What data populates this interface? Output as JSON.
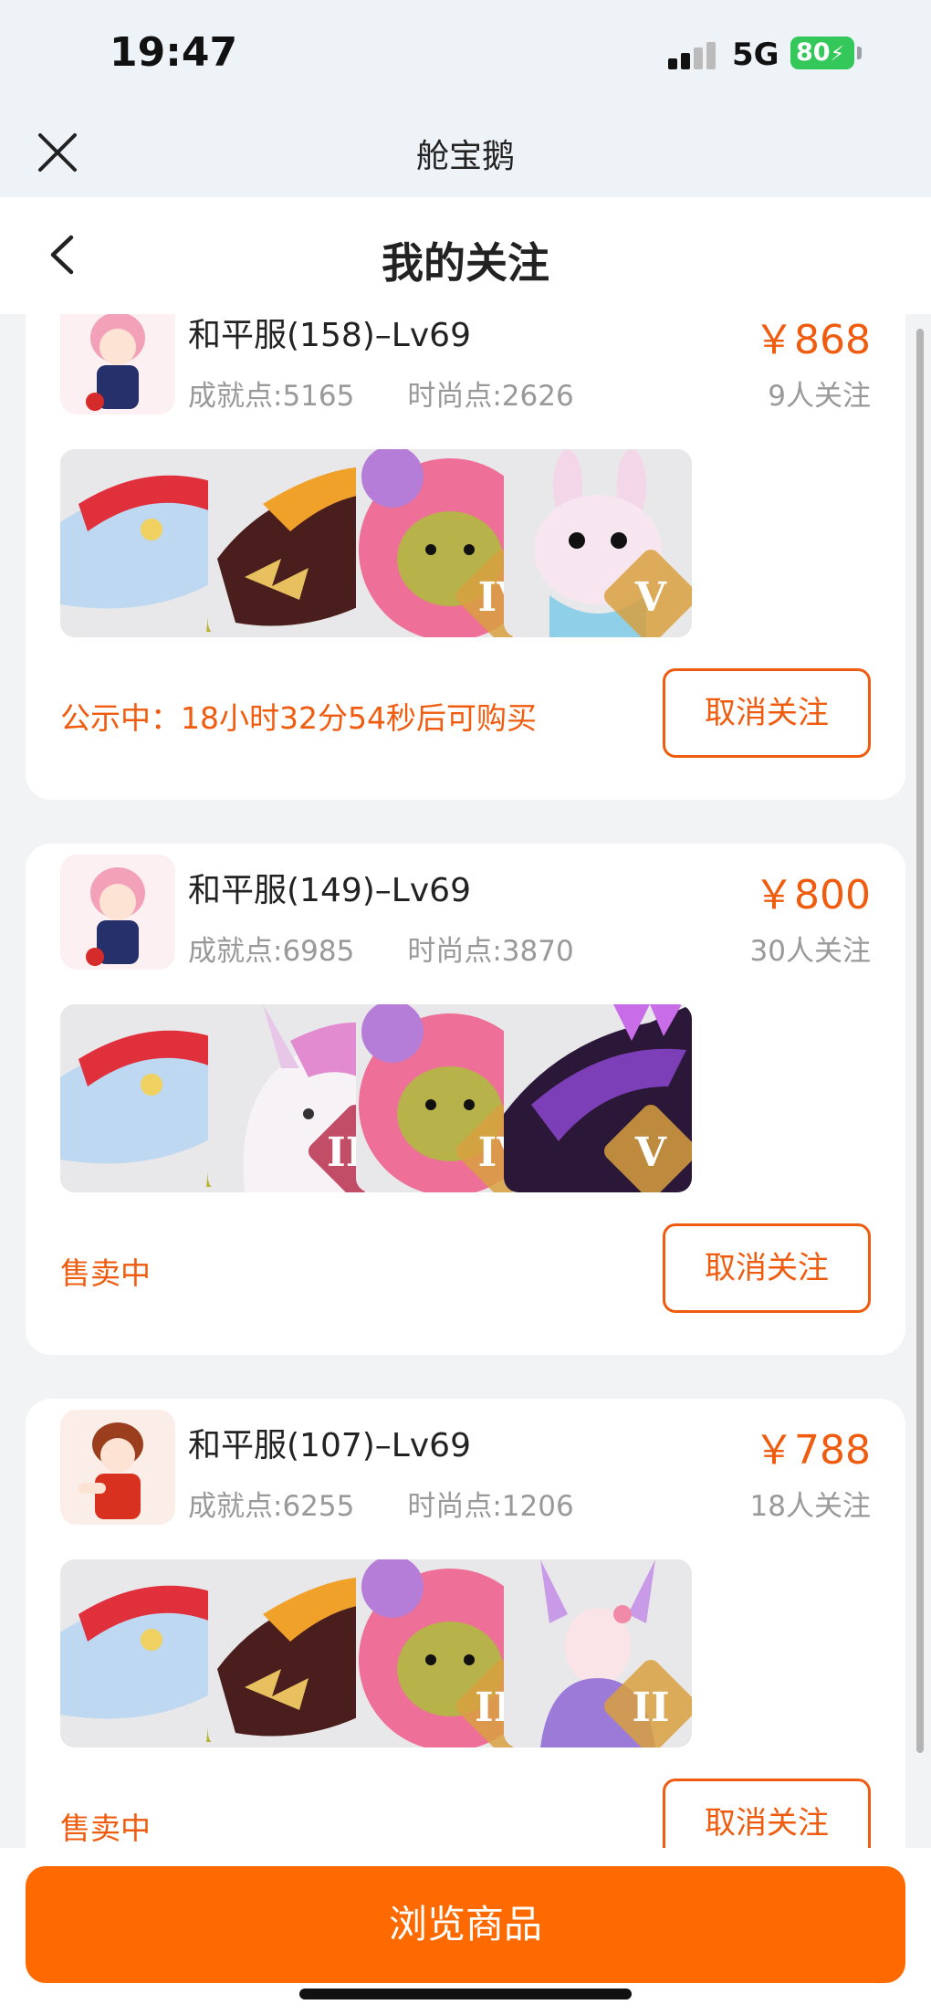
{
  "status_bar": {
    "time": "19:47",
    "network": "5G",
    "battery": "80"
  },
  "mini_app": {
    "title": "舱宝鹅"
  },
  "page": {
    "title": "我的关注"
  },
  "cards": [
    {
      "server": "和平服(158)–Lv69",
      "achievement": "成就点:5165",
      "fashion": "时尚点:2626",
      "price": "￥868",
      "followers": "9人关注",
      "status": "公示中：18小时32分54秒后可购买",
      "button": "取消关注",
      "items": [
        {
          "icon": "whale-mount",
          "badge": ""
        },
        {
          "icon": "dragon-mount",
          "badge": ""
        },
        {
          "icon": "pink-bear-pet",
          "badge": "IV"
        },
        {
          "icon": "rabbit-pet",
          "badge": "V"
        }
      ]
    },
    {
      "server": "和平服(149)–Lv69",
      "achievement": "成就点:6985",
      "fashion": "时尚点:3870",
      "price": "￥800",
      "followers": "30人关注",
      "status": "售卖中",
      "button": "取消关注",
      "items": [
        {
          "icon": "whale-mount",
          "badge": ""
        },
        {
          "icon": "unicorn-mount",
          "badge": "III"
        },
        {
          "icon": "pink-bear-pet",
          "badge": "IV"
        },
        {
          "icon": "dark-dragon-mount",
          "badge": "V"
        }
      ]
    },
    {
      "server": "和平服(107)–Lv69",
      "achievement": "成就点:6255",
      "fashion": "时尚点:1206",
      "price": "￥788",
      "followers": "18人关注",
      "status": "售卖中",
      "button": "取消关注",
      "items": [
        {
          "icon": "whale-mount",
          "badge": ""
        },
        {
          "icon": "dragon-mount",
          "badge": ""
        },
        {
          "icon": "pink-bear-pet",
          "badge": "III"
        },
        {
          "icon": "fox-spirit-pet",
          "badge": "II"
        }
      ]
    }
  ],
  "footer": {
    "browse_button": "浏览商品"
  },
  "colors": {
    "accent": "#ff6a00",
    "price": "#f05c0f",
    "muted": "#999999"
  }
}
